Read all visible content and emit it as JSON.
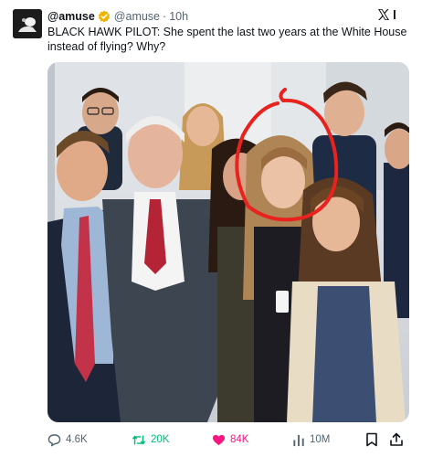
{
  "tweet": {
    "display_name": "@amuse",
    "handle": "@amuse",
    "separator": "·",
    "time": "10h",
    "text": "BLACK HAWK PILOT: She spent the last two years at the White House instead of flying? Why?",
    "verified_badge": "verified-badge-icon",
    "brand_logo": "x-logo-icon",
    "more_label": "l",
    "photo": {
      "description_icon": "group-photo",
      "highlight_color": "#e8231f"
    }
  },
  "actions": {
    "replies": "4.6K",
    "reposts": "20K",
    "likes": "84K",
    "views": "10M"
  },
  "colors": {
    "text": "#0f1419",
    "muted": "#536471",
    "repost": "#00ba7c",
    "like": "#f91880",
    "verified": "#f0b400"
  }
}
